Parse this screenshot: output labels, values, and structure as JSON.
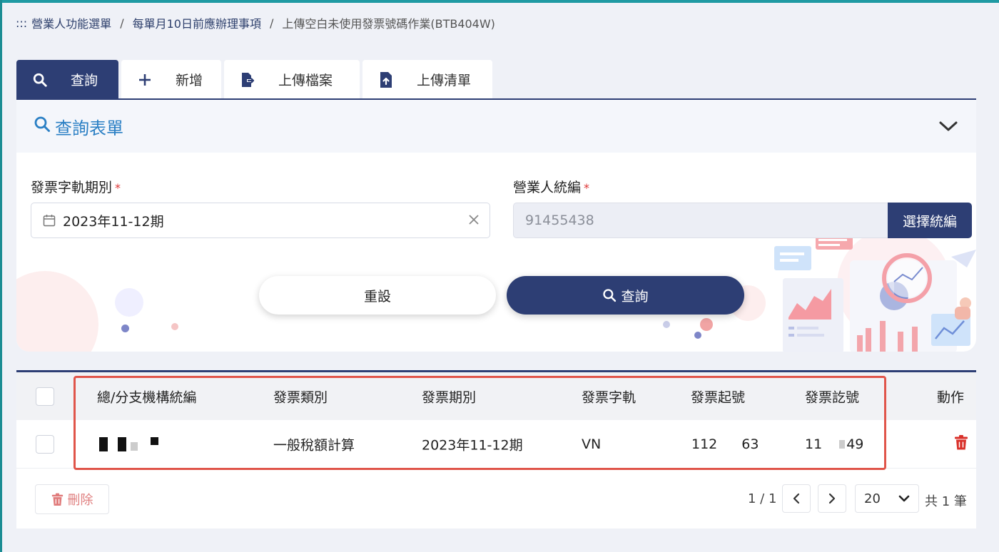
{
  "breadcrumb": {
    "prefix": ":::",
    "items": [
      "營業人功能選單",
      "每單月10日前應辦理事項"
    ],
    "current": "上傳空白未使用發票號碼作業(BTB404W)",
    "separator": "/"
  },
  "tabs": [
    {
      "label": "查詢",
      "icon": "search-icon",
      "active": true
    },
    {
      "label": "新增",
      "icon": "plus-icon",
      "active": false
    },
    {
      "label": "上傳檔案",
      "icon": "file-export-icon",
      "active": false
    },
    {
      "label": "上傳清單",
      "icon": "file-upload-icon",
      "active": false
    }
  ],
  "form": {
    "title": "查詢表單",
    "period_label": "發票字軌期別",
    "period_value": "2023年11-12期",
    "required_mark": "*",
    "ban_label": "營業人統編",
    "ban_value": "91455438",
    "ban_button": "選擇統編",
    "reset_button": "重設",
    "query_button": "查詢"
  },
  "table": {
    "headers": [
      "總/分支機構統編",
      "發票類別",
      "發票期別",
      "發票字軌",
      "發票起號",
      "發票訖號",
      "動作"
    ],
    "rows": [
      {
        "ban": "",
        "category": "一般稅額計算",
        "period": "2023年11-12期",
        "track": "VN",
        "start_a": "112",
        "start_b": "63",
        "end_a": "11",
        "end_b": "49"
      }
    ]
  },
  "footer": {
    "delete_button": "刪除",
    "page_info": "1 / 1",
    "page_size": "20",
    "total": "共 1 筆"
  },
  "colors": {
    "primary": "#2d3e74",
    "link": "#2a7fc4",
    "danger": "#d9302a",
    "highlight": "#e0554a"
  }
}
